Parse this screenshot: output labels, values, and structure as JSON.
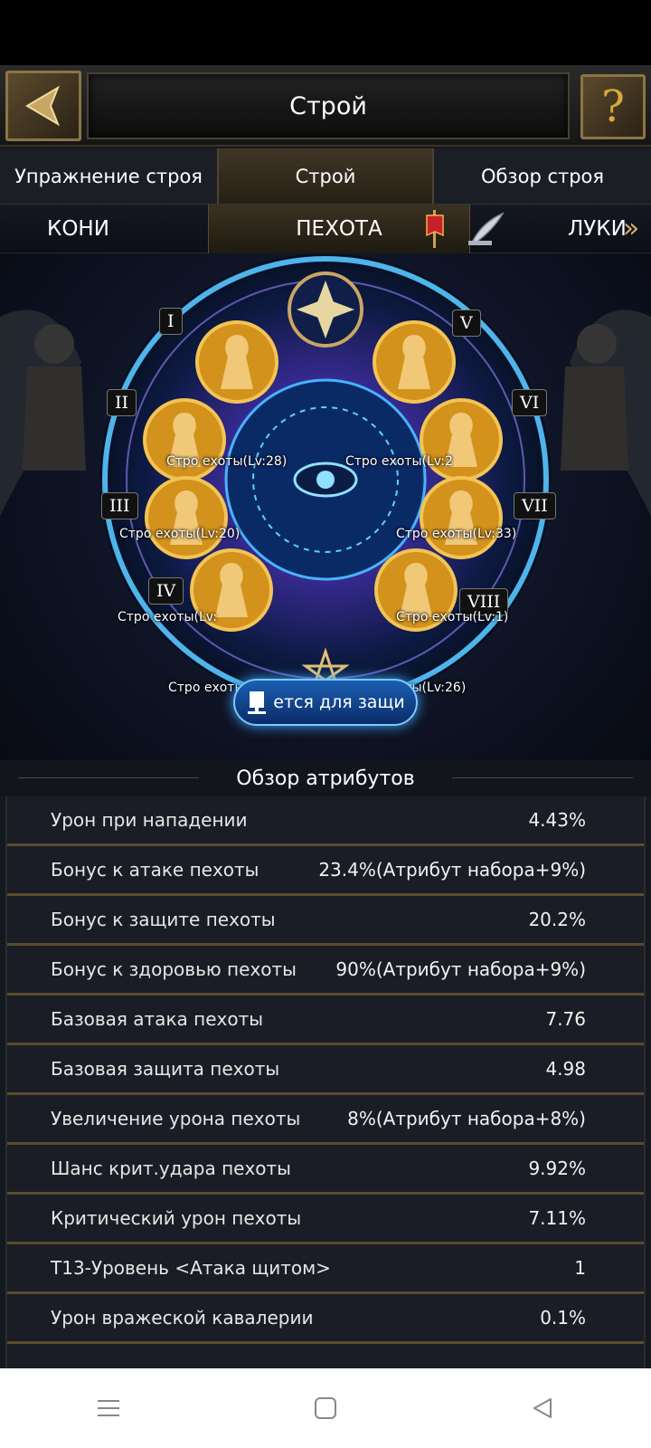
{
  "header": {
    "title": "Строй"
  },
  "tabs": [
    {
      "label": "Упражнение строя",
      "active": false
    },
    {
      "label": "Строй",
      "active": true
    },
    {
      "label": "Обзор строя",
      "active": false
    }
  ],
  "troop_bar": {
    "left": "КОНИ",
    "center": "ПЕХОТА",
    "right": "ЛУКИ"
  },
  "formation": {
    "slots": [
      {
        "numeral": "I",
        "caption": "Стро   ехоты(Lv:28)"
      },
      {
        "numeral": "II",
        "caption": "Стро   ехоты(Lv:20)"
      },
      {
        "numeral": "III",
        "caption": "Стро   ехоты(Lv:"
      },
      {
        "numeral": "IV",
        "caption": "Стро   ехоты(Lv:20)"
      },
      {
        "numeral": "V",
        "caption": "Стро   ехоты(Lv:2"
      },
      {
        "numeral": "VI",
        "caption": "Стро   ехоты(Lv:33)"
      },
      {
        "numeral": "VII",
        "caption": "Стро   ехоты(Lv:1)"
      },
      {
        "numeral": "VIII",
        "caption": "Стро   ехоты(Lv:26)"
      }
    ],
    "defend_button": "ется для защи"
  },
  "overview": {
    "title": "Обзор атрибутов",
    "rows": [
      {
        "label": "Урон при нападении",
        "value": "4.43%"
      },
      {
        "label": "Бонус к атаке пехоты",
        "value": "23.4%(Атрибут набора+9%)"
      },
      {
        "label": "Бонус к защите пехоты",
        "value": "20.2%"
      },
      {
        "label": "Бонус к здоровью пехоты",
        "value": "90%(Атрибут набора+9%)"
      },
      {
        "label": "Базовая атака пехоты",
        "value": "7.76"
      },
      {
        "label": "Базовая защита пехоты",
        "value": "4.98"
      },
      {
        "label": "Увеличение урона пехоты",
        "value": "8%(Атрибут набора+8%)"
      },
      {
        "label": "Шанс крит.удара пехоты",
        "value": "9.92%"
      },
      {
        "label": "Критический урон пехоты",
        "value": "7.11%"
      },
      {
        "label": "T13-Уровень <Атака щитом>",
        "value": "1"
      },
      {
        "label": "Урон вражеской кавалерии",
        "value": "0.1%"
      }
    ]
  },
  "icons": {
    "back": "back-arrow-icon",
    "help": "question-mark-icon",
    "quill": "quill-icon",
    "banner": "red-banner-icon",
    "next": "chevron-right-icon"
  },
  "colors": {
    "gold": "#d4b16a",
    "accent_blue": "#3fa8ff",
    "row_divider": "#5a4c2c"
  }
}
